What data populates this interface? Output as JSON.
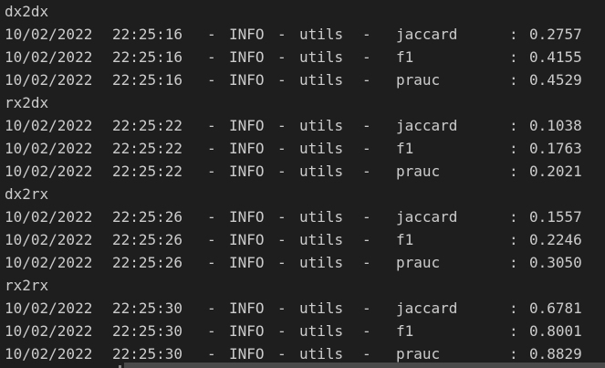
{
  "terminal": {
    "lines": [
      {
        "type": "header",
        "text": "dx2dx"
      },
      {
        "type": "log",
        "date": "10/02/2022",
        "time": "22:25:16",
        "level": "INFO",
        "module": "utils",
        "metric": "jaccard",
        "value": "0.2757"
      },
      {
        "type": "log",
        "date": "10/02/2022",
        "time": "22:25:16",
        "level": "INFO",
        "module": "utils",
        "metric": "f1",
        "value": "0.4155"
      },
      {
        "type": "log",
        "date": "10/02/2022",
        "time": "22:25:16",
        "level": "INFO",
        "module": "utils",
        "metric": "prauc",
        "value": "0.4529"
      },
      {
        "type": "header",
        "text": "rx2dx"
      },
      {
        "type": "log",
        "date": "10/02/2022",
        "time": "22:25:22",
        "level": "INFO",
        "module": "utils",
        "metric": "jaccard",
        "value": "0.1038"
      },
      {
        "type": "log",
        "date": "10/02/2022",
        "time": "22:25:22",
        "level": "INFO",
        "module": "utils",
        "metric": "f1",
        "value": "0.1763"
      },
      {
        "type": "log",
        "date": "10/02/2022",
        "time": "22:25:22",
        "level": "INFO",
        "module": "utils",
        "metric": "prauc",
        "value": "0.2021"
      },
      {
        "type": "header",
        "text": "dx2rx"
      },
      {
        "type": "log",
        "date": "10/02/2022",
        "time": "22:25:26",
        "level": "INFO",
        "module": "utils",
        "metric": "jaccard",
        "value": "0.1557"
      },
      {
        "type": "log",
        "date": "10/02/2022",
        "time": "22:25:26",
        "level": "INFO",
        "module": "utils",
        "metric": "f1",
        "value": "0.2246"
      },
      {
        "type": "log",
        "date": "10/02/2022",
        "time": "22:25:26",
        "level": "INFO",
        "module": "utils",
        "metric": "prauc",
        "value": "0.3050"
      },
      {
        "type": "header",
        "text": "rx2rx"
      },
      {
        "type": "log",
        "date": "10/02/2022",
        "time": "22:25:30",
        "level": "INFO",
        "module": "utils",
        "metric": "jaccard",
        "value": "0.6781"
      },
      {
        "type": "log",
        "date": "10/02/2022",
        "time": "22:25:30",
        "level": "INFO",
        "module": "utils",
        "metric": "f1",
        "value": "0.8001"
      },
      {
        "type": "log",
        "date": "10/02/2022",
        "time": "22:25:30",
        "level": "INFO",
        "module": "utils",
        "metric": "prauc",
        "value": "0.8829"
      }
    ],
    "separator": "-",
    "colon": ":"
  },
  "colors": {
    "background": "#1e1e1e",
    "text": "#cccccc",
    "scrollbar": "#4a4a4a"
  }
}
